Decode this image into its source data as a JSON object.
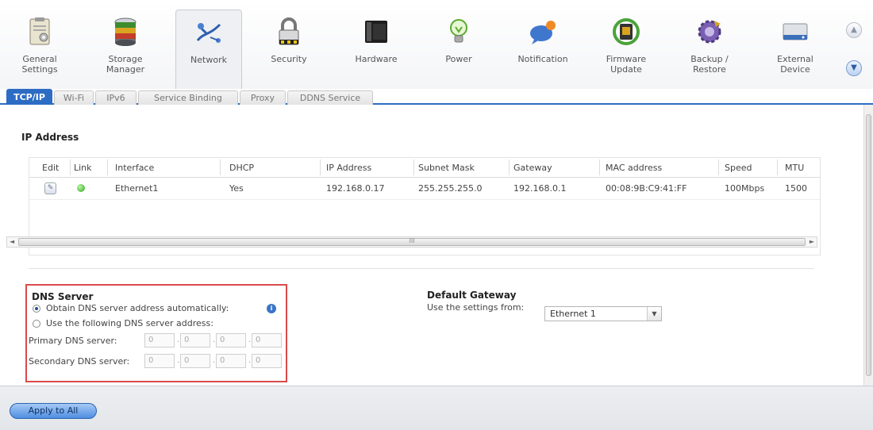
{
  "toolbar": {
    "items": [
      {
        "label": "General\nSettings",
        "icon": "clipboard-icon"
      },
      {
        "label": "Storage\nManager",
        "icon": "database-icon"
      },
      {
        "label": "Network",
        "icon": "network-icon"
      },
      {
        "label": "Security",
        "icon": "padlock-icon"
      },
      {
        "label": "Hardware",
        "icon": "server-icon"
      },
      {
        "label": "Power",
        "icon": "lightbulb-icon"
      },
      {
        "label": "Notification",
        "icon": "speech-bubble-icon"
      },
      {
        "label": "Firmware\nUpdate",
        "icon": "firmware-chip-icon"
      },
      {
        "label": "Backup /\nRestore",
        "icon": "backup-gear-icon"
      },
      {
        "label": "External\nDevice",
        "icon": "external-drive-icon"
      }
    ],
    "selected": "Network"
  },
  "tabs": [
    "TCP/IP",
    "Wi-Fi",
    "IPv6",
    "Service Binding",
    "Proxy",
    "DDNS Service"
  ],
  "active_tab": "TCP/IP",
  "ip_section": {
    "title": "IP Address",
    "columns": [
      "Edit",
      "Link",
      "Interface",
      "DHCP",
      "IP Address",
      "Subnet Mask",
      "Gateway",
      "MAC address",
      "Speed",
      "MTU"
    ],
    "rows": [
      {
        "interface": "Ethernet1",
        "dhcp": "Yes",
        "ip": "192.168.0.17",
        "subnet": "255.255.255.0",
        "gateway": "192.168.0.1",
        "mac": "00:08:9B:C9:41:FF",
        "speed": "100Mbps",
        "mtu": "1500",
        "link_status": "up"
      }
    ],
    "hscroll_grip": "III"
  },
  "dns": {
    "title": "DNS Server",
    "auto_label": "Obtain DNS server address automatically:",
    "manual_label": "Use the following DNS server address:",
    "primary_label": "Primary DNS server:",
    "secondary_label": "Secondary DNS server:",
    "selected": "auto",
    "primary": [
      "0",
      "0",
      "0",
      "0"
    ],
    "secondary": [
      "0",
      "0",
      "0",
      "0"
    ]
  },
  "gateway": {
    "title": "Default Gateway",
    "use_label": "Use the settings from:",
    "selected": "Ethernet 1"
  },
  "footer": {
    "apply_label": "Apply to All"
  },
  "colors": {
    "tab_active": "#2c6cc4",
    "dns_highlight": "#d94a4a",
    "link_up": "#2fa61d",
    "button_blue": "#4f8ee2"
  }
}
